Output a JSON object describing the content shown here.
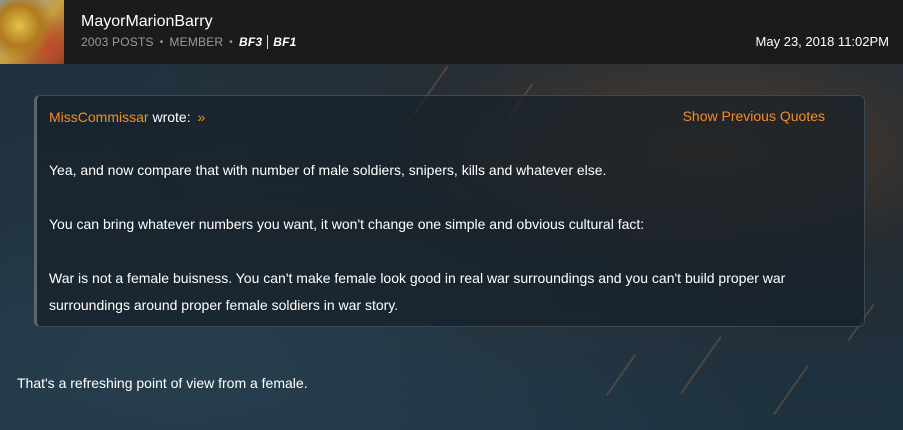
{
  "post": {
    "username": "MayorMarionBarry",
    "posts_count": "2003 POSTS",
    "role": "MEMBER",
    "games": [
      "BF3",
      "BF1"
    ],
    "timestamp": "May 23, 2018 11:02PM"
  },
  "quote": {
    "author": "MissCommissar",
    "wrote_label": "wrote:",
    "arrow": "»",
    "show_previous_label": "Show Previous Quotes",
    "paragraphs": [
      "Yea, and now compare that with number of male soldiers, snipers, kills and whatever else.",
      "You can bring whatever numbers you want, it won't change one simple and obvious cultural fact:",
      "War is not a female buisness. You can't make female look good in real war surroundings and you can't build proper war surroundings around proper female soldiers in war story."
    ]
  },
  "reply": {
    "text": "That's a refreshing point of view from a female."
  },
  "colors": {
    "accent": "#f28c28",
    "header_bg": "#1b1b1b"
  }
}
